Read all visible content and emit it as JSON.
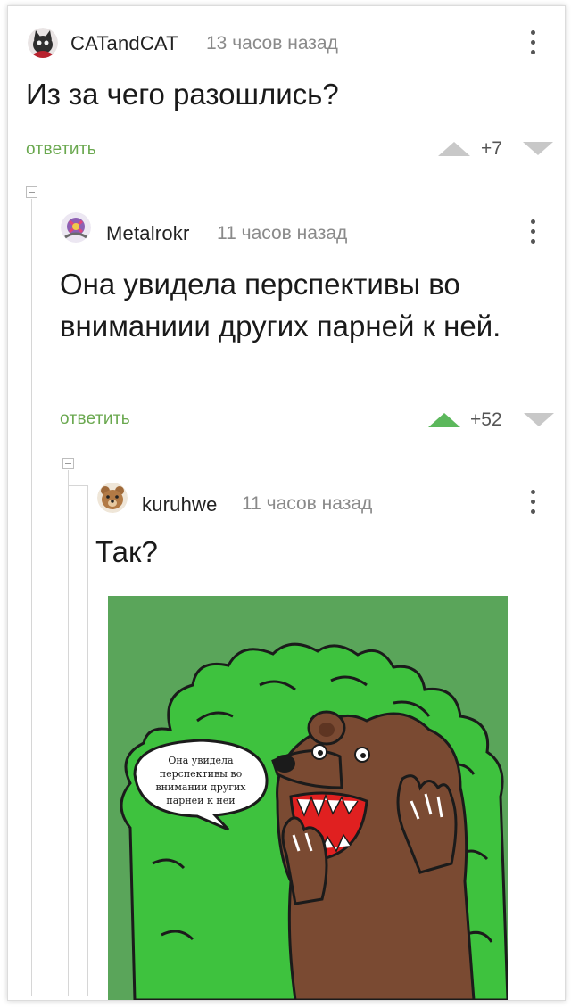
{
  "comments": [
    {
      "username": "CATandCAT",
      "time": "13 часов назад",
      "text": "Из за чего разошлись?",
      "reply_label": "ответить",
      "rating": "+7"
    },
    {
      "username": "Metalrokr",
      "time": "11 часов назад",
      "text": "Она увидела перспективы во вниманиии других парней к ней.",
      "reply_label": "ответить",
      "rating": "+52"
    },
    {
      "username": "kuruhwe",
      "time": "11 часов назад",
      "text": "Так?",
      "image": {
        "speech_bubble": [
          "Она увидела",
          "перспективы во",
          "внимании других",
          "парней к ней"
        ]
      }
    }
  ],
  "colors": {
    "reply_green": "#6aa84f",
    "upvote_active": "#5cb85c",
    "arrow_inactive": "#c8c8c8",
    "meme_background": "#5aa55a",
    "bush_green": "#3ec23e",
    "bear_brown": "#7a4a32"
  },
  "icons": [
    "cat-avatar-icon",
    "metal-avatar-icon",
    "bear-avatar-icon",
    "kebab-menu-icon",
    "upvote-icon",
    "downvote-icon",
    "collapse-icon"
  ]
}
